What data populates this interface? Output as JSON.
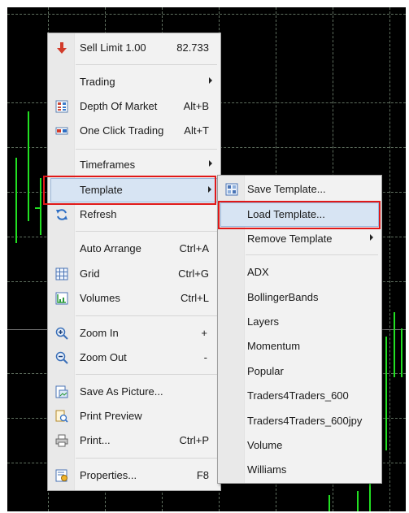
{
  "colors": {
    "chart_bg": "#000000",
    "candle": "#22e022",
    "menu_bg": "#f2f2f2",
    "highlight": "#d7e4f3",
    "callout": "#e01818"
  },
  "context_menu": {
    "sell_limit": {
      "label": "Sell Limit 1.00",
      "value": "82.733",
      "icon": "sell-arrow-icon"
    },
    "trading": {
      "label": "Trading"
    },
    "depth_of_market": {
      "label": "Depth Of Market",
      "shortcut": "Alt+B",
      "icon": "depth-of-market-icon"
    },
    "one_click_trading": {
      "label": "One Click Trading",
      "shortcut": "Alt+T",
      "icon": "one-click-trading-icon"
    },
    "timeframes": {
      "label": "Timeframes"
    },
    "template": {
      "label": "Template"
    },
    "refresh": {
      "label": "Refresh",
      "icon": "refresh-icon"
    },
    "auto_arrange": {
      "label": "Auto Arrange",
      "shortcut": "Ctrl+A"
    },
    "grid": {
      "label": "Grid",
      "shortcut": "Ctrl+G",
      "icon": "grid-icon"
    },
    "volumes": {
      "label": "Volumes",
      "shortcut": "Ctrl+L",
      "icon": "volumes-icon"
    },
    "zoom_in": {
      "label": "Zoom In",
      "shortcut": "+",
      "icon": "zoom-in-icon"
    },
    "zoom_out": {
      "label": "Zoom Out",
      "shortcut": "-",
      "icon": "zoom-out-icon"
    },
    "save_as_picture": {
      "label": "Save As Picture...",
      "icon": "save-picture-icon"
    },
    "print_preview": {
      "label": "Print Preview",
      "icon": "print-preview-icon"
    },
    "print": {
      "label": "Print...",
      "shortcut": "Ctrl+P",
      "icon": "printer-icon"
    },
    "properties": {
      "label": "Properties...",
      "shortcut": "F8",
      "icon": "properties-icon"
    }
  },
  "template_submenu": {
    "save_template": {
      "label": "Save Template...",
      "icon": "save-template-icon"
    },
    "load_template": {
      "label": "Load Template..."
    },
    "remove_template": {
      "label": "Remove Template"
    },
    "templates": [
      "ADX",
      "BollingerBands",
      "Layers",
      "Momentum",
      "Popular",
      "Traders4Traders_600",
      "Traders4Traders_600jpy",
      "Volume",
      "Williams"
    ]
  }
}
